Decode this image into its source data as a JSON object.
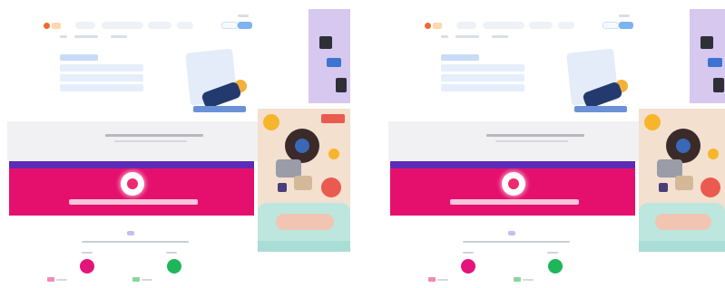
{
  "theme": {
    "accent_pink": "#e5106d",
    "accent_purple": "#5c2bb8",
    "accent_green": "#1fb55a",
    "accent_blue": "#7db4ef",
    "logo_orange": "#ee6b2f"
  },
  "panels": [
    {
      "id": "left",
      "nav": {
        "items": [
          "",
          "",
          "",
          ""
        ],
        "button": ""
      },
      "heading": "",
      "stats": [
        "",
        ""
      ]
    },
    {
      "id": "right",
      "nav": {
        "items": [
          "",
          "",
          "",
          ""
        ],
        "button": ""
      },
      "heading": "",
      "stats": [
        "",
        ""
      ]
    }
  ],
  "icons": [
    "logo-icon",
    "illustration-person-icon",
    "eye-icon",
    "ring-chart-icon"
  ]
}
